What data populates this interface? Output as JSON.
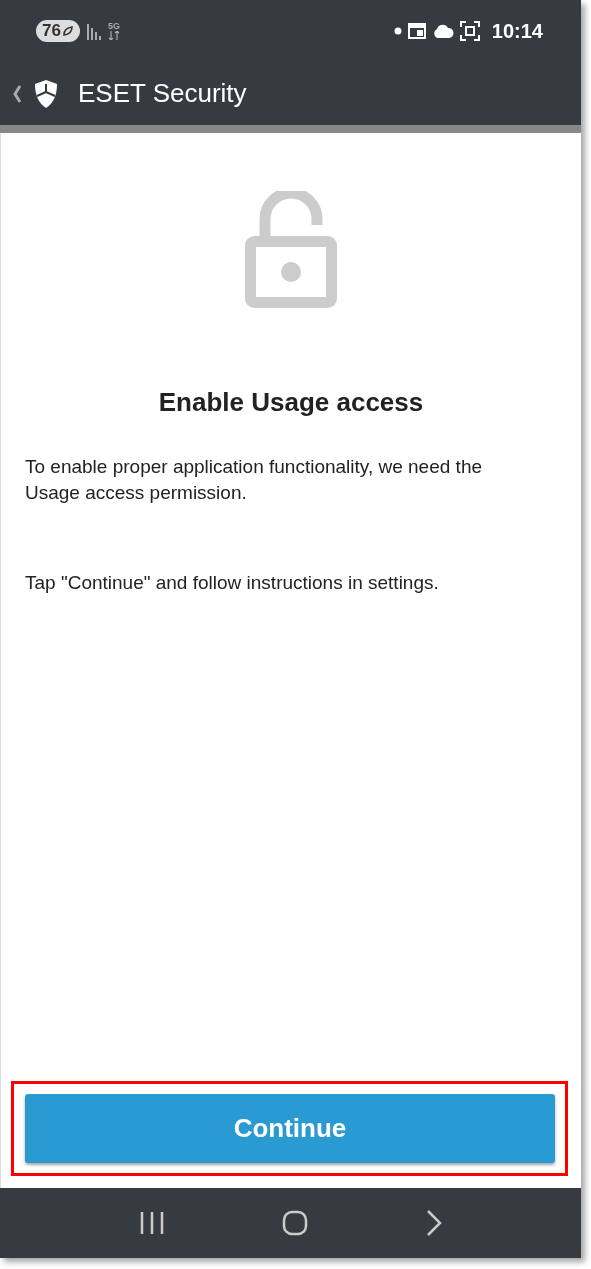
{
  "status_bar": {
    "battery": "76",
    "network": "5G",
    "time": "10:14"
  },
  "app_bar": {
    "title": "ESET Security"
  },
  "content": {
    "title": "Enable Usage access",
    "paragraphs": [
      "To enable proper application functionality, we need the Usage access permission.",
      "Tap \"Continue\" and follow instructions in settings."
    ]
  },
  "continue_button": {
    "label": "Continue",
    "highlighted": true
  }
}
